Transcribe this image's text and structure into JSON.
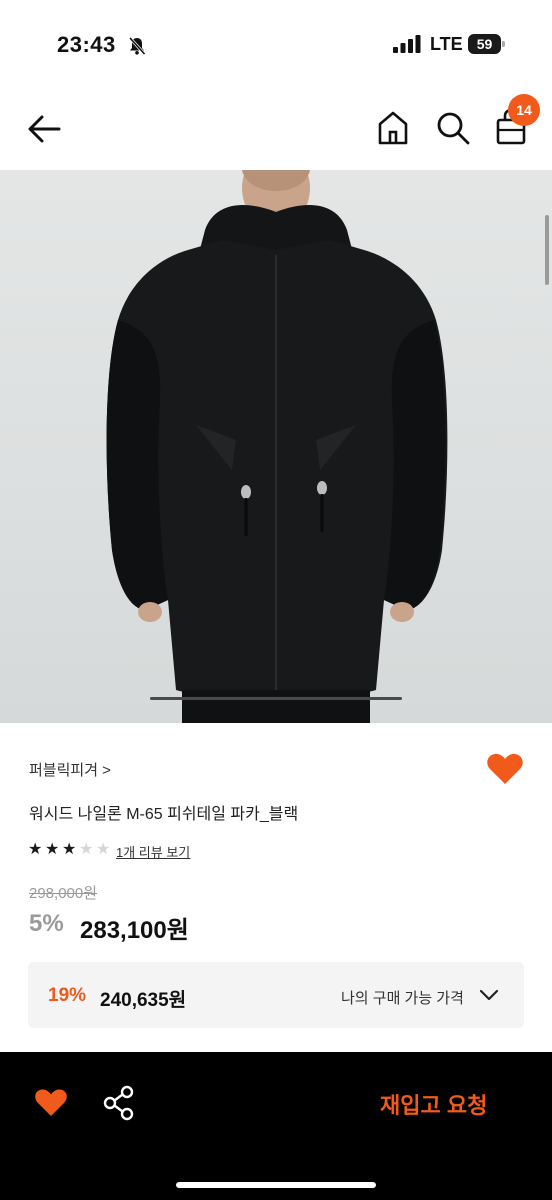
{
  "status_bar": {
    "time": "23:43",
    "network": "LTE",
    "battery": "59"
  },
  "nav": {
    "cart_count": "14"
  },
  "product": {
    "brand": "퍼블릭피겨 >",
    "title": "워시드 나일론 M-65 피쉬테일 파카_블랙",
    "rating_stars": 3,
    "rating_max": 5,
    "review_link": "1개 리뷰 보기",
    "original_price": "298,000원",
    "discount_rate": "5%",
    "sale_price": "283,100원",
    "buyable": {
      "rate": "19%",
      "price": "240,635원",
      "label": "나의 구매 가능 가격"
    }
  },
  "bottom_bar": {
    "restock_label": "재입고 요청"
  },
  "colors": {
    "accent": "#f05a1a",
    "bottom_bar_bg": "#000000"
  },
  "icons": [
    "bell-slash-icon",
    "signal-icon",
    "battery-icon",
    "back-arrow-icon",
    "home-icon",
    "search-icon",
    "shopping-bag-icon",
    "heart-icon",
    "share-icon",
    "chevron-down-icon"
  ]
}
